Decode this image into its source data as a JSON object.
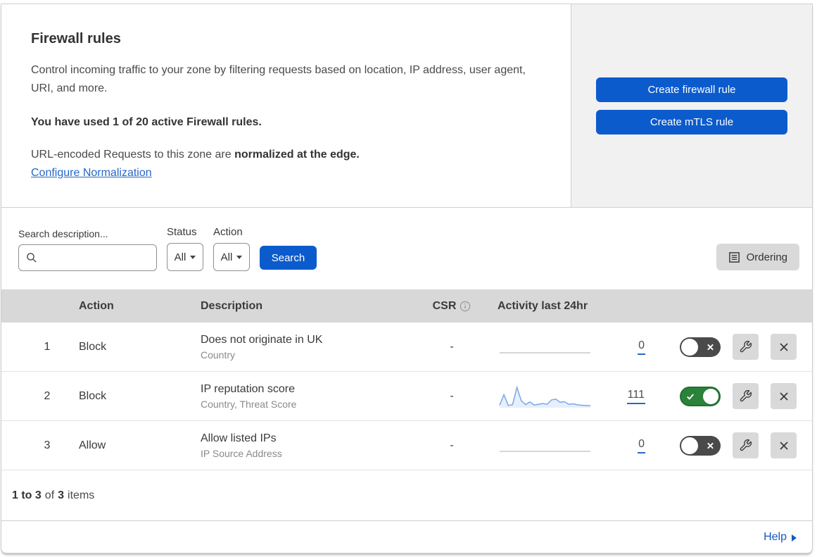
{
  "colors": {
    "accent_blue": "#0b5bcd",
    "link_blue": "#2767c9",
    "help_blue": "#1259c3",
    "toggle_on_green": "#2b823a",
    "toggle_off_gray": "#4a4a4a",
    "sparkline_blue": "#7aa7e9",
    "flatline_gray": "#c9c9c9",
    "table_header_gray": "#d8d8d8",
    "panel_gray": "#f1f1f1",
    "icon_button_gray": "#d9d9d9"
  },
  "intro": {
    "title": "Firewall rules",
    "description": "Control incoming traffic to your zone by filtering requests based on location, IP address, user agent, URI, and more.",
    "usage": "You have used 1 of 20 active Firewall rules.",
    "normalization_prefix": "URL-encoded Requests to this zone are ",
    "normalization_bold": "normalized at the edge.",
    "normalization_link": "Configure Normalization",
    "create_firewall_label": "Create firewall rule",
    "create_mtls_label": "Create mTLS rule"
  },
  "filters": {
    "search_label": "Search description...",
    "search_value": "",
    "status_label": "Status",
    "status_value": "All",
    "action_label": "Action",
    "action_value": "All",
    "search_button_label": "Search",
    "ordering_label": "Ordering"
  },
  "table": {
    "columns": {
      "action": "Action",
      "description": "Description",
      "csr": "CSR",
      "activity": "Activity last 24hr"
    },
    "rows": [
      {
        "num": "1",
        "action": "Block",
        "description": "Does not originate in UK",
        "fields": "Country",
        "csr": "-",
        "count": "0",
        "enabled": false,
        "has_activity": false
      },
      {
        "num": "2",
        "action": "Block",
        "description": "IP reputation score",
        "fields": "Country, Threat Score",
        "csr": "-",
        "count": "111",
        "enabled": true,
        "has_activity": true
      },
      {
        "num": "3",
        "action": "Allow",
        "description": "Allow listed IPs",
        "fields": "IP Source Address",
        "csr": "-",
        "count": "0",
        "enabled": false,
        "has_activity": false
      }
    ]
  },
  "footer": {
    "range": "1 to 3",
    "of_label": "of",
    "total": "3",
    "items_label": "items",
    "help_label": "Help"
  },
  "chart_data": {
    "type": "line",
    "title": "Activity last 24hr sparkline (rule 2: IP reputation score)",
    "values": [
      10,
      62,
      8,
      12,
      100,
      32,
      12,
      26,
      10,
      14,
      18,
      14,
      36,
      40,
      24,
      27,
      14,
      16,
      11,
      9,
      8,
      7
    ],
    "ylim": [
      0,
      100
    ],
    "total_events": 111,
    "note": "rules 1 and 3 show flat zero-activity lines with count 0"
  }
}
